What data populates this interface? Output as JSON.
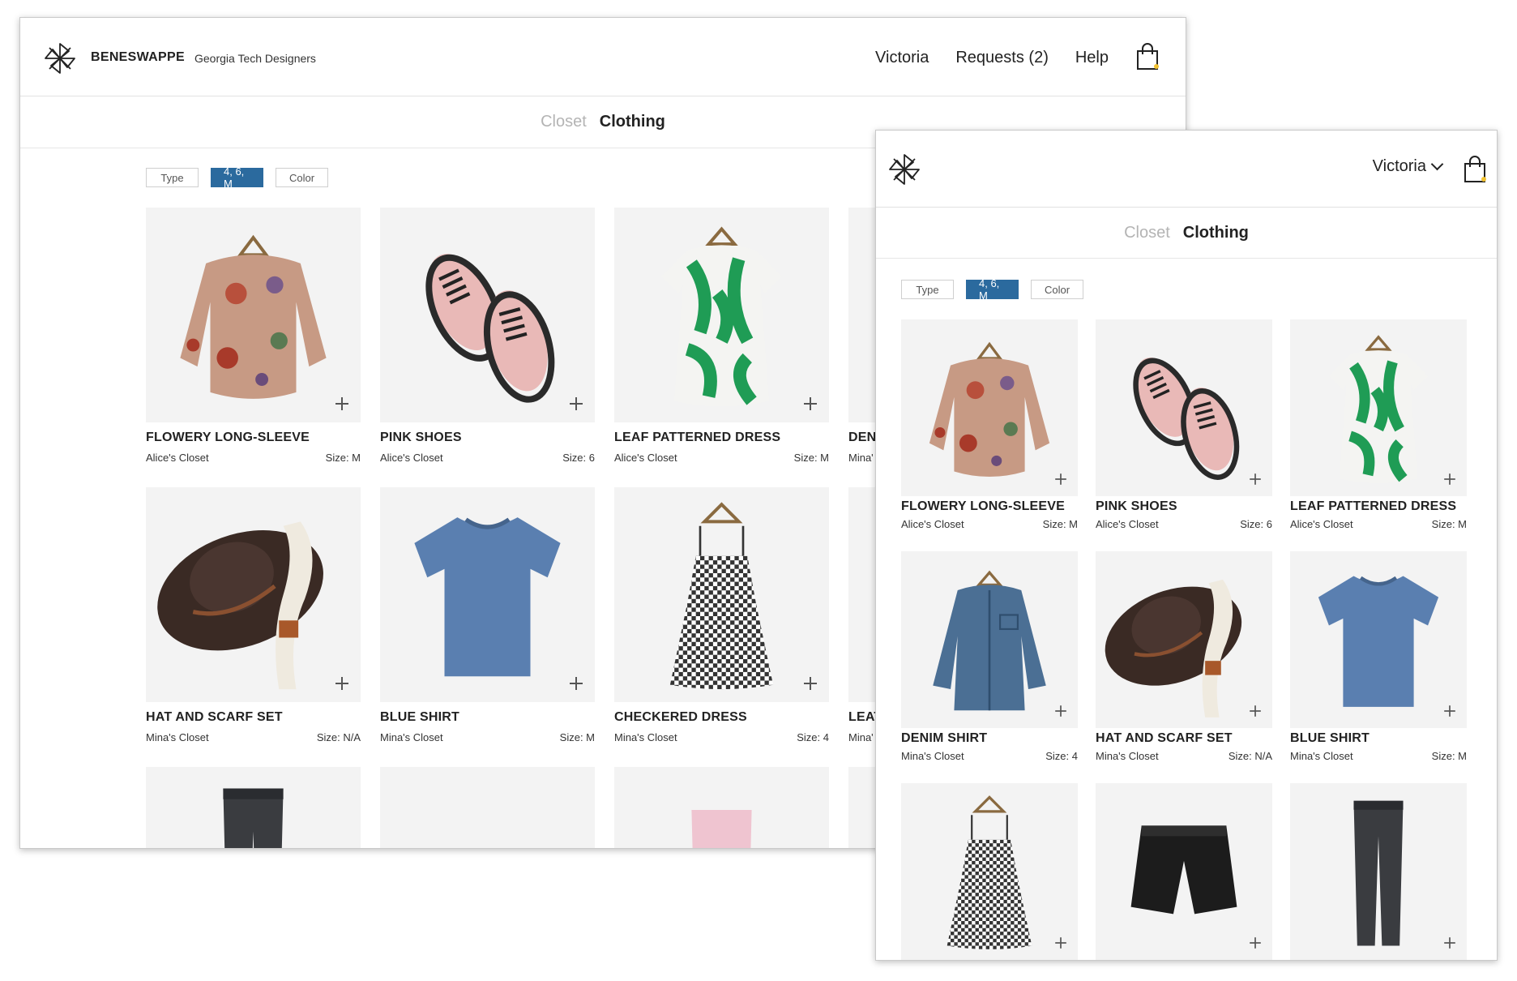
{
  "desktop": {
    "brand": "BENESWAPPE",
    "org": "Georgia Tech Designers",
    "nav": [
      "Victoria",
      "Requests (2)",
      "Help"
    ],
    "crumbs": {
      "parent": "Closet",
      "current": "Clothing"
    },
    "filters": [
      {
        "label": "Type",
        "active": false
      },
      {
        "label": "4, 6, M",
        "active": true
      },
      {
        "label": "Color",
        "active": false
      }
    ],
    "items": [
      {
        "title": "FLOWERY LONG-SLEEVE",
        "closet": "Alice's Closet",
        "size": "Size: M",
        "icon": "floral-top"
      },
      {
        "title": "PINK SHOES",
        "closet": "Alice's Closet",
        "size": "Size: 6",
        "icon": "pink-shoes"
      },
      {
        "title": "LEAF PATTERNED DRESS",
        "closet": "Alice's Closet",
        "size": "Size: M",
        "icon": "leaf-dress"
      },
      {
        "title": "DEN",
        "closet": "Mina'",
        "size": "",
        "icon": "denim-shirt"
      },
      {
        "title": "HAT AND SCARF SET",
        "closet": "Mina's Closet",
        "size": "Size: N/A",
        "icon": "hat-scarf"
      },
      {
        "title": "BLUE SHIRT",
        "closet": "Mina's Closet",
        "size": "Size: M",
        "icon": "blue-tee"
      },
      {
        "title": "CHECKERED DRESS",
        "closet": "Mina's Closet",
        "size": "Size: 4",
        "icon": "check-dress"
      },
      {
        "title": "LEAT",
        "closet": "Mina'",
        "size": "",
        "icon": "leather-shorts"
      },
      {
        "title": "",
        "closet": "",
        "size": "",
        "icon": "black-jeans"
      },
      {
        "title": "",
        "closet": "",
        "size": "",
        "icon": "floral-skirt"
      },
      {
        "title": "",
        "closet": "",
        "size": "",
        "icon": "pink-jeans"
      },
      {
        "title": "",
        "closet": "",
        "size": "",
        "icon": "blank"
      }
    ]
  },
  "tablet": {
    "user": "Victoria",
    "crumbs": {
      "parent": "Closet",
      "current": "Clothing"
    },
    "filters": [
      {
        "label": "Type",
        "active": false
      },
      {
        "label": "4, 6, M",
        "active": true
      },
      {
        "label": "Color",
        "active": false
      }
    ],
    "items": [
      {
        "title": "FLOWERY LONG-SLEEVE",
        "closet": "Alice's Closet",
        "size": "Size: M",
        "icon": "floral-top"
      },
      {
        "title": "PINK SHOES",
        "closet": "Alice's Closet",
        "size": "Size: 6",
        "icon": "pink-shoes"
      },
      {
        "title": "LEAF PATTERNED DRESS",
        "closet": "Alice's Closet",
        "size": "Size: M",
        "icon": "leaf-dress"
      },
      {
        "title": "DENIM SHIRT",
        "closet": "Mina's Closet",
        "size": "Size: 4",
        "icon": "denim-shirt"
      },
      {
        "title": "HAT AND SCARF SET",
        "closet": "Mina's Closet",
        "size": "Size: N/A",
        "icon": "hat-scarf"
      },
      {
        "title": "BLUE SHIRT",
        "closet": "Mina's Closet",
        "size": "Size: M",
        "icon": "blue-tee"
      },
      {
        "title": "",
        "closet": "",
        "size": "",
        "icon": "check-dress"
      },
      {
        "title": "",
        "closet": "",
        "size": "",
        "icon": "leather-shorts"
      },
      {
        "title": "",
        "closet": "",
        "size": "",
        "icon": "black-jeans"
      }
    ]
  },
  "colors": {
    "accent": "#2b6a9e",
    "cart_dot": "#f2c230",
    "thumb_bg": "#f3f3f3"
  }
}
